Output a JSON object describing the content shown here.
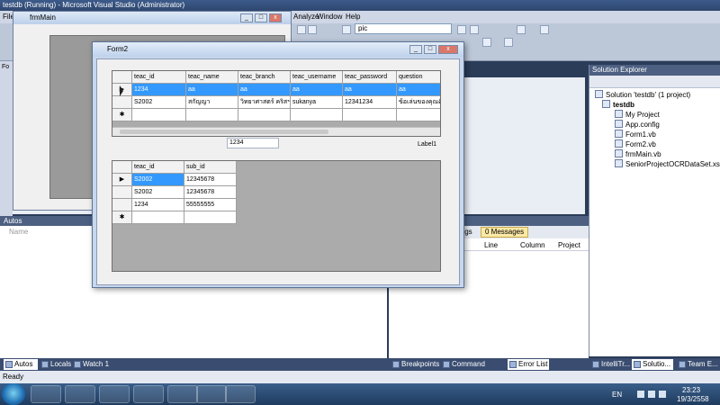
{
  "window": {
    "title": "testdb (Running) - Microsoft Visual Studio (Administrator)"
  },
  "menu": {
    "items": [
      "File",
      "Analyze",
      "Window",
      "Help"
    ]
  },
  "toolbar": {
    "config_combo": "pic"
  },
  "frmmain": {
    "title": "frmMain"
  },
  "form2": {
    "title": "Form2",
    "grid1": {
      "headers": [
        "teac_id",
        "teac_name",
        "teac_branch",
        "teac_username",
        "teac_password",
        "question"
      ],
      "rows": [
        [
          "1234",
          "aa",
          "aa",
          "aa",
          "aa",
          "aa"
        ],
        [
          "S2002",
          "สกัญญา",
          "วิทยาศาสตร์ คริสฯ",
          "sukanya",
          "12341234",
          "ข้อเล่นของคุณคือ"
        ]
      ]
    },
    "textbox_value": "1234",
    "label1": "Label1",
    "grid2": {
      "headers": [
        "teac_id",
        "sub_id"
      ],
      "rows": [
        [
          "S2002",
          "12345678"
        ],
        [
          "S2002",
          "12345678"
        ],
        [
          "1234",
          "55555555"
        ]
      ]
    }
  },
  "solution_explorer": {
    "title": "Solution Explorer",
    "items": [
      "Solution 'testdb' (1 project)",
      "testdb",
      "My Project",
      "App.config",
      "Form1.vb",
      "Form2.vb",
      "frmMain.vb",
      "SeniorProjectOCRDataSet.xsd"
    ]
  },
  "autos": {
    "title": "Autos",
    "col_name": "Name"
  },
  "error_list": {
    "tab_warnings": "ings",
    "tab_messages": "0 Messages",
    "columns": [
      "Line",
      "Column",
      "Project"
    ]
  },
  "bottom_tabs": [
    "Autos",
    "Locals",
    "Watch 1",
    "Breakpoints",
    "Command Window",
    "Error List",
    "IntelliTr...",
    "Solutio...",
    "Team E..."
  ],
  "status": {
    "text": "Ready"
  },
  "left_strip": {
    "label": "Fo"
  },
  "tray": {
    "lang": "EN",
    "time": "23:23",
    "date": "19/3/2558"
  }
}
